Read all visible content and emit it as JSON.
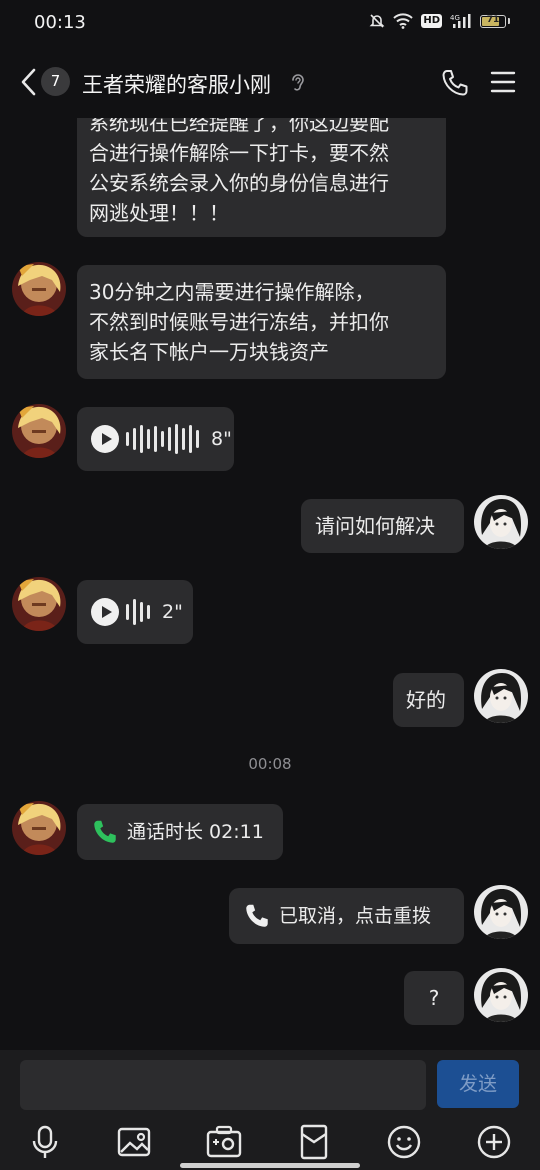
{
  "status_bar": {
    "time": "00:13",
    "icons": [
      "mute-bell-icon",
      "wifi-icon",
      "hd-icon",
      "signal-4g-icon",
      "battery-icon"
    ],
    "hd": "HD",
    "network": "4G",
    "battery_percent": "71",
    "battery_level": 0.71
  },
  "header": {
    "unread_count": "7",
    "title": "王者荣耀的客服小刚",
    "icons": [
      "back-chevron-icon",
      "ear-icon",
      "phone-icon",
      "menu-icon"
    ]
  },
  "messages": [
    {
      "type": "text",
      "side": "left",
      "text": "系统现在已经提醒了，你这边要配\n合进行操作解除一下打卡，要不然\n公安系统会录入你的身份信息进行\n网逃处理！！！"
    },
    {
      "type": "text",
      "side": "left",
      "text": "30分钟之内需要进行操作解除，\n不然到时候账号进行冻结，并扣你\n家长名下帐户一万块钱资产"
    },
    {
      "type": "voice",
      "side": "left",
      "duration": "8\""
    },
    {
      "type": "text",
      "side": "right",
      "text": "请问如何解决"
    },
    {
      "type": "voice",
      "side": "left",
      "duration": "2\""
    },
    {
      "type": "text",
      "side": "right",
      "text": "好的"
    },
    {
      "type": "timestamp",
      "text": "00:08"
    },
    {
      "type": "call",
      "side": "left",
      "text": "通话时长 02:11"
    },
    {
      "type": "call",
      "side": "right",
      "text": "已取消，点击重拨"
    },
    {
      "type": "text",
      "side": "right",
      "text": "?"
    }
  ],
  "input_bar": {
    "send_label": "发送",
    "tools": [
      "microphone-icon",
      "image-icon",
      "camera-icon",
      "red-packet-icon",
      "emoji-icon",
      "plus-icon"
    ]
  },
  "colors": {
    "background": "#111113",
    "bubble": "#2c2c2e",
    "send_button": "#1c4f93",
    "call_green": "#2ec15d"
  }
}
